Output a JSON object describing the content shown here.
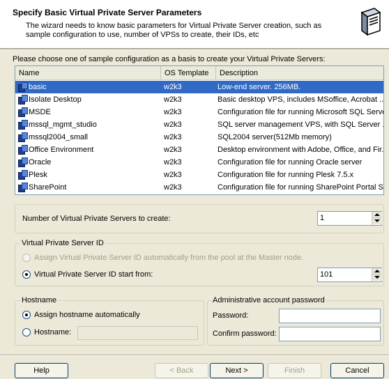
{
  "header": {
    "title": "Specify Basic Virtual Private Server Parameters",
    "description": "The wizard needs to know basic parameters for Virtual Private Server creation, such as sample configuration to use, number of VPSs to create, their IDs, etc",
    "icon": "server-wizard-icon"
  },
  "choose_label": "Please choose one of sample configuration as a basis to create your Virtual Private Servers:",
  "config_list": {
    "columns": [
      "Name",
      "OS Template",
      "Description"
    ],
    "selected_index": 0,
    "rows": [
      {
        "name": "basic",
        "os": "w2k3",
        "desc": "Low-end server. 256MB."
      },
      {
        "name": "Isolate Desktop",
        "os": "w2k3",
        "desc": "Basic desktop VPS, includes MSoffice, Acrobat ..."
      },
      {
        "name": "MSDE",
        "os": "w2k3",
        "desc": "Configuration file for running Microsoft SQL Serve..."
      },
      {
        "name": "mssql_mgmt_studio",
        "os": "w2k3",
        "desc": "SQL server management VPS, with SQL Server ..."
      },
      {
        "name": "mssql2004_small",
        "os": "w2k3",
        "desc": "SQL2004 server(512Mb memory)"
      },
      {
        "name": "Office Environment",
        "os": "w2k3",
        "desc": "Desktop environment with Adobe, Office, and Fir..."
      },
      {
        "name": "Oracle",
        "os": "w2k3",
        "desc": "Configuration file for running Oracle server"
      },
      {
        "name": "Plesk",
        "os": "w2k3",
        "desc": "Configuration file for running Plesk 7.5.x"
      },
      {
        "name": "SharePoint",
        "os": "w2k3",
        "desc": "Configuration file for running SharePoint Portal Se..."
      }
    ]
  },
  "count": {
    "label": "Number of Virtual Private Servers to create:",
    "value": "1"
  },
  "vps_id": {
    "group_title": "Virtual Private Server ID",
    "auto_label": "Assign Virtual Private Server ID automatically from the pool at the Master node.",
    "start_label": "Virtual Private Server ID start from:",
    "start_value": "101"
  },
  "hostname": {
    "group_title": "Hostname",
    "auto_label": "Assign hostname automatically",
    "manual_label": "Hostname:",
    "value": ""
  },
  "admin_password": {
    "group_title": "Administrative account password",
    "password_label": "Password:",
    "confirm_label": "Confirm password:"
  },
  "buttons": {
    "help": "Help",
    "back": "< Back",
    "next": "Next >",
    "finish": "Finish",
    "cancel": "Cancel"
  }
}
